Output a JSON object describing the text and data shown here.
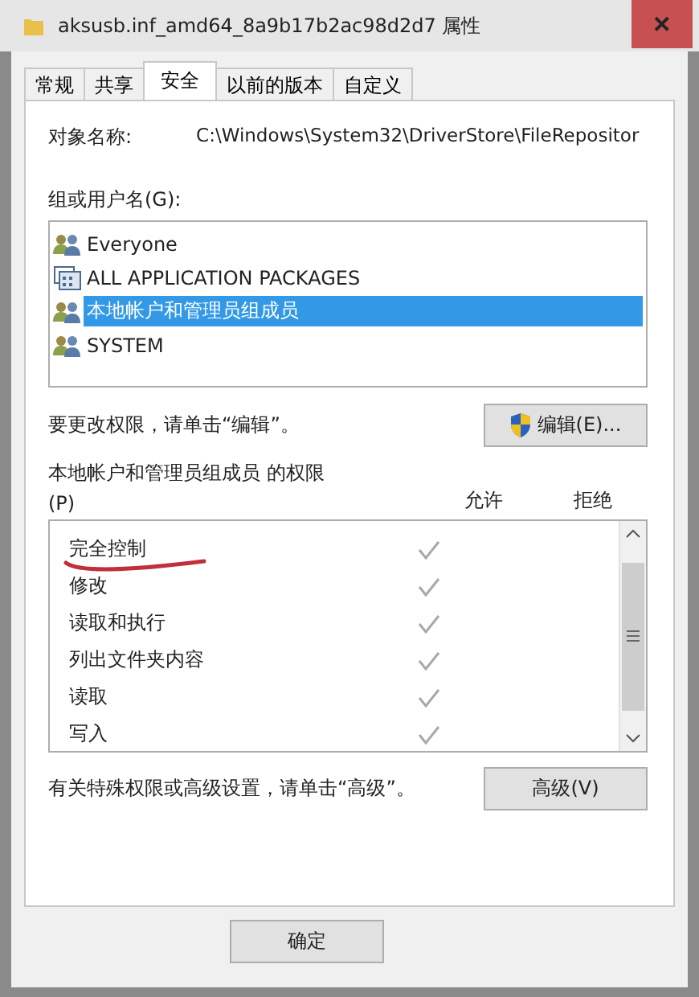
{
  "window": {
    "title": "aksusb.inf_amd64_8a9b17b2ac98d2d7 属性",
    "close": "✕"
  },
  "tabs": [
    {
      "label": "常规",
      "selected": false
    },
    {
      "label": "共享",
      "selected": false
    },
    {
      "label": "安全",
      "selected": true
    },
    {
      "label": "以前的版本",
      "selected": false
    },
    {
      "label": "自定义",
      "selected": false
    }
  ],
  "object_name": {
    "label": "对象名称:",
    "value": "C:\\Windows\\System32\\DriverStore\\FileRepositor"
  },
  "groups": {
    "label": "组或用户名(G):",
    "items": [
      {
        "name": "Everyone",
        "kind": "users",
        "selected": false
      },
      {
        "name": "ALL APPLICATION PACKAGES",
        "kind": "packages",
        "selected": false
      },
      {
        "name": "本地帐户和管理员组成员",
        "kind": "users",
        "selected": true
      },
      {
        "name": "SYSTEM",
        "kind": "users",
        "selected": false
      }
    ]
  },
  "edit_hint": "要更改权限，请单击“编辑”。",
  "edit_button": "编辑(E)...",
  "permissions": {
    "label": "本地帐户和管理员组成员 的权限",
    "label_suffix": "(P)",
    "columns": [
      "允许",
      "拒绝"
    ],
    "rows": [
      {
        "name": "完全控制",
        "allow": true,
        "deny": false,
        "underlined": true
      },
      {
        "name": "修改",
        "allow": true,
        "deny": false,
        "underlined": false
      },
      {
        "name": "读取和执行",
        "allow": true,
        "deny": false,
        "underlined": false
      },
      {
        "name": "列出文件夹内容",
        "allow": true,
        "deny": false,
        "underlined": false
      },
      {
        "name": "读取",
        "allow": true,
        "deny": false,
        "underlined": false
      },
      {
        "name": "写入",
        "allow": true,
        "deny": false,
        "underlined": false
      }
    ]
  },
  "advanced_hint": "有关特殊权限或高级设置，请单击“高级”。",
  "advanced_button": "高级(V)",
  "buttons": [
    "确定"
  ]
}
